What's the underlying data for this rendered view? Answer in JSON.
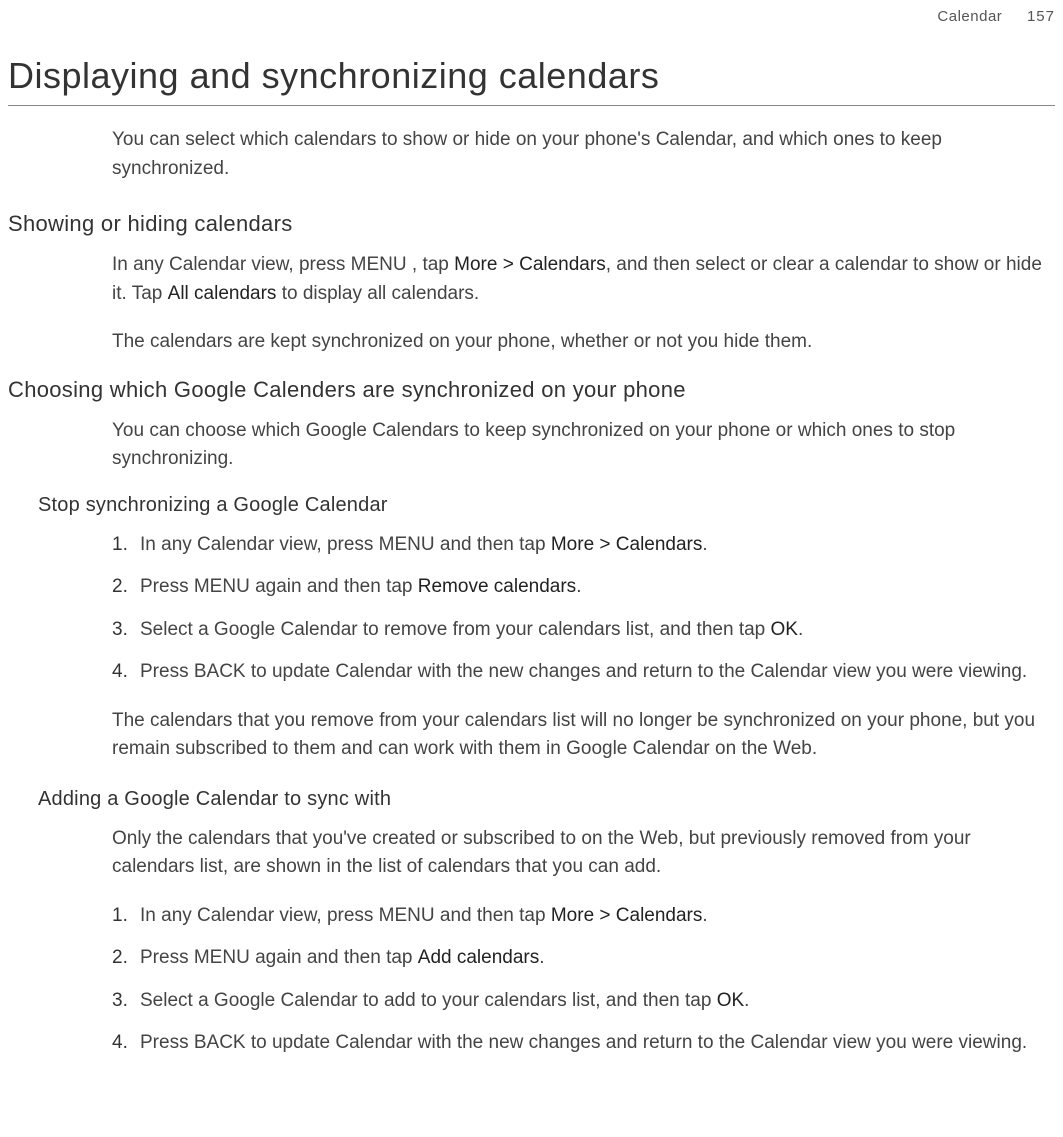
{
  "header": {
    "section": "Calendar",
    "page": "157"
  },
  "title": "Displaying and synchronizing calendars",
  "intro": "You can select which calendars to show or hide on your phone's Calendar, and which ones to keep synchronized.",
  "section1": {
    "heading": "Showing or hiding calendars",
    "para1_a": "In any Calendar view, press MENU , tap ",
    "para1_b": "More > Calendars",
    "para1_c": ", and then select or clear a calendar to show or hide it. Tap ",
    "para1_d": "All calendars",
    "para1_e": " to display all calendars.",
    "para2": "The calendars are kept synchronized on your phone, whether or not you hide them."
  },
  "section2": {
    "heading": "Choosing which Google Calenders are synchronized on your phone",
    "para": "You can choose which Google Calendars to keep synchronized on your phone or which ones to stop synchronizing.",
    "sub1": {
      "heading": "Stop synchronizing a Google Calendar",
      "steps": [
        {
          "a": "In any Calendar view, press MENU and then tap ",
          "b": "More > Calendars",
          "c": "."
        },
        {
          "a": "Press MENU again and then tap ",
          "b": "Remove calendars",
          "c": "."
        },
        {
          "a": "Select a Google Calendar to remove from your calendars list, and then tap ",
          "b": "OK",
          "c": "."
        },
        {
          "a": "Press BACK to update Calendar with the new changes and return to the Calendar view you were viewing.",
          "b": "",
          "c": ""
        }
      ],
      "note": "The calendars that you remove from your calendars list will no longer be synchronized on your phone, but you remain subscribed to them and can work with them in Google Calendar on the Web."
    },
    "sub2": {
      "heading": "Adding a Google Calendar to sync with",
      "para": "Only the calendars that you've created or subscribed to on the Web, but previously removed from your calendars list, are shown in the list of calendars that you can add.",
      "steps": [
        {
          "a": "In any Calendar view, press MENU and then tap ",
          "b": "More > Calendars",
          "c": "."
        },
        {
          "a": "Press MENU again and then tap ",
          "b": "Add calendars",
          "c": "."
        },
        {
          "a": "Select a Google Calendar to add to your calendars list, and then tap ",
          "b": "OK",
          "c": "."
        },
        {
          "a": "Press BACK to update Calendar with the new changes and return to the Calendar view you were viewing.",
          "b": "",
          "c": ""
        }
      ]
    }
  }
}
